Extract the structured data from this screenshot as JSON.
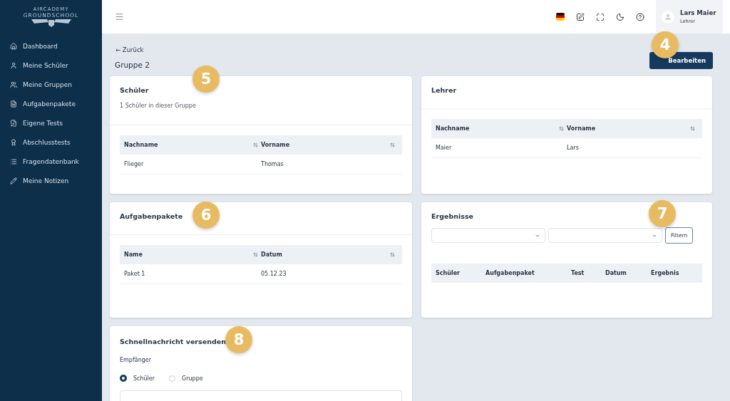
{
  "logo": {
    "line_1": "AIRCADEMY",
    "line_2": "GROUNDSCHOOL"
  },
  "sidebar": {
    "items": [
      {
        "label": "Dashboard"
      },
      {
        "label": "Meine Schüler"
      },
      {
        "label": "Meine Gruppen"
      },
      {
        "label": "Aufgabenpakete"
      },
      {
        "label": "Eigene Tests"
      },
      {
        "label": "Abschlusstests"
      },
      {
        "label": "Fragendatenbank"
      },
      {
        "label": "Meine Notizen"
      }
    ]
  },
  "user": {
    "name": "Lars Maier",
    "role": "Lehrer"
  },
  "back_link": "← Zurück",
  "page_title": "Gruppe 2",
  "edit_button": "Bearbeiten",
  "students_card": {
    "title": "Schüler",
    "subtitle": "1 Schüler in dieser Gruppe",
    "columns": [
      "Nachname",
      "Vorname"
    ],
    "rows": [
      [
        "Flieger",
        "Thomas"
      ]
    ]
  },
  "teachers_card": {
    "title": "Lehrer",
    "columns": [
      "Nachname",
      "Vorname"
    ],
    "rows": [
      [
        "Maier",
        "Lars"
      ]
    ]
  },
  "packages_card": {
    "title": "Aufgabenpakete",
    "columns": [
      "Name",
      "Datum"
    ],
    "rows": [
      [
        "Paket 1",
        "05.12.23"
      ]
    ]
  },
  "results_card": {
    "title": "Ergebnisse",
    "filter_button": "Filtern",
    "columns": [
      "Schüler",
      "Aufgabenpaket",
      "Test",
      "Datum",
      "Ergebnis"
    ]
  },
  "message_card": {
    "title": "Schnellnachricht versenden",
    "recipient_label": "Empfänger",
    "options": [
      {
        "label": "Schüler",
        "selected": true
      },
      {
        "label": "Gruppe",
        "selected": false
      }
    ]
  },
  "callouts": [
    "4",
    "5",
    "6",
    "7",
    "8"
  ]
}
